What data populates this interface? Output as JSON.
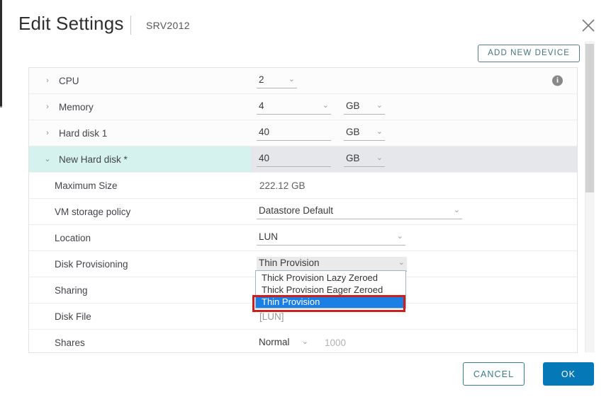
{
  "header": {
    "title": "Edit Settings",
    "subtitle": "SRV2012",
    "close_icon": "close-icon"
  },
  "toolbar": {
    "add_new_device_label": "ADD NEW DEVICE"
  },
  "device_rows": [
    {
      "label": "CPU",
      "expander": "›",
      "value": "2",
      "unit": null,
      "info_icon": "info-icon"
    },
    {
      "label": "Memory",
      "expander": "›",
      "value": "4",
      "unit": "GB"
    },
    {
      "label": "Hard disk 1",
      "expander": "›",
      "value": "40",
      "unit": "GB"
    },
    {
      "label": "New Hard disk *",
      "expander": "⌄",
      "value": "40",
      "unit": "GB"
    }
  ],
  "disk_details": [
    {
      "label": "Maximum Size",
      "value": "222.12 GB"
    },
    {
      "label": "VM storage policy",
      "value": "Datastore Default"
    },
    {
      "label": "Location",
      "value": "LUN"
    },
    {
      "label": "Disk Provisioning",
      "value": "Thin Provision"
    },
    {
      "label": "Sharing",
      "value": ""
    },
    {
      "label": "Disk File",
      "value": "[LUN]"
    },
    {
      "label": "Shares",
      "value": "Normal",
      "secondary_value": "1000"
    }
  ],
  "disk_provisioning_dropdown": {
    "open": true,
    "options": [
      "Thick Provision Lazy Zeroed",
      "Thick Provision Eager Zeroed",
      "Thin Provision"
    ],
    "selected": "Thin Provision",
    "annotation_color": "#cc1f1f",
    "selection_color": "#1b7fe3"
  },
  "footer": {
    "cancel_label": "CANCEL",
    "ok_label": "OK",
    "ok_color": "#0579b8"
  },
  "icons": {
    "chevron_right": "›",
    "chevron_down": "⌄",
    "info_glyph": "i"
  }
}
